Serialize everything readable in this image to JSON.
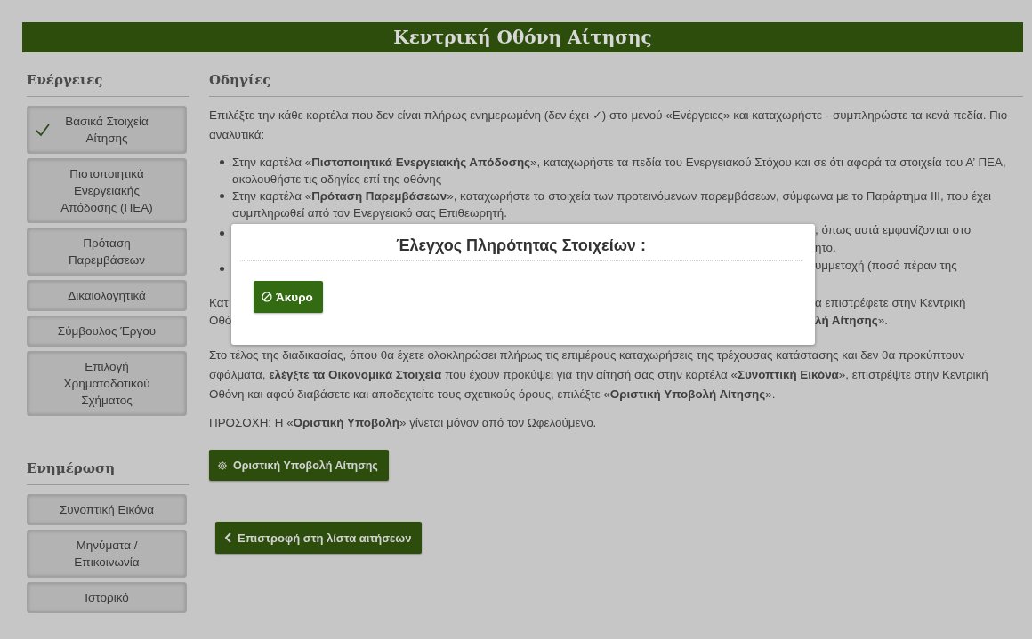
{
  "header": {
    "title": "Κεντρική Οθόνη Αίτησης"
  },
  "sidebar": {
    "sections": [
      {
        "title": "Ενέργειες",
        "items": [
          {
            "label": "Βασικά Στοιχεία Αίτησης",
            "completed": true
          },
          {
            "label": "Πιστοποιητικά Ενεργειακής Απόδοσης (ΠΕΑ)",
            "completed": false
          },
          {
            "label": "Πρόταση Παρεμβάσεων",
            "completed": false
          },
          {
            "label": "Δικαιολογητικά",
            "completed": false
          },
          {
            "label": "Σύμβουλος Έργου",
            "completed": false
          },
          {
            "label": "Επιλογή Χρηματοδοτικού Σχήματος",
            "completed": false
          }
        ]
      },
      {
        "title": "Ενημέρωση",
        "items": [
          {
            "label": "Συνοπτική Εικόνα",
            "completed": false
          },
          {
            "label": "Μηνύματα / Επικοινωνία",
            "completed": false
          },
          {
            "label": "Ιστορικό",
            "completed": false
          }
        ]
      }
    ]
  },
  "instructions": {
    "title": "Οδηγίες",
    "blocks": [
      {
        "kind": "paragraph",
        "text": "Επιλέξτε την κάθε καρτέλα που δεν είναι πλήρως ενημερωμένη (δεν έχει ✓) στο μενού «Ενέργειες» και καταχωρήστε - συμπληρώστε τα κενά πεδία. Πιο αναλυτικά:"
      },
      {
        "kind": "bullet",
        "text": "Στην καρτέλα «**Πιστοποιητικά Ενεργειακής Απόδοσης**», καταχωρήστε τα πεδία του Ενεργειακού Στόχου και σε ότι αφορά τα στοιχεία του Α’ ΠΕΑ,  ακολουθήστε τις οδηγίες επί της οθόνης"
      },
      {
        "kind": "bullet",
        "text": "Στην καρτέλα «**Πρόταση Παρεμβάσεων**», καταχωρήστε τα στοιχεία των προτεινόμενων παρεμβάσεων, σύμφωνα με το Παράρτημα ΙΙΙ, που έχει συμπληρωθεί από τον Ενεργειακό σας Επιθεωρητή."
      },
      {
        "kind": "covered",
        "lines": [
          {
            "bullet": true,
            "right": ", όπως αυτά εμφανίζονται στο"
          },
          {
            "bullet": false,
            "right": "ητο."
          },
          {
            "bullet": true,
            "right": "υμμετοχή (ποσό πέραν της"
          }
        ]
      },
      {
        "kind": "covered",
        "lines": [
          {
            "bullet": false,
            "left": "Κατ",
            "right": "α επιστρέφετε στην Κεντρική"
          },
          {
            "bullet": false,
            "left": "Οθό",
            "right": "**λή Αίτησης**»."
          }
        ]
      },
      {
        "kind": "paragraph",
        "text": "Στο τέλος της διαδικασίας, όπου θα έχετε ολοκληρώσει πλήρως τις επιμέρους καταχωρήσεις της τρέχουσας κατάστασης και δεν θα προκύπτουν σφάλματα, **ελέγξτε τα Οικονομικά Στοιχεία** που έχουν προκύψει για την αίτησή σας στην καρτέλα «**Συνοπτική Εικόνα**», επιστρέψτε στην Κεντρική Οθόνη και αφού διαβάσετε και αποδεχτείτε τους σχετικούς όρους, επιλέξτε «**Οριστική Υποβολή Αίτησης**»."
      },
      {
        "kind": "paragraph",
        "text": "ΠΡΟΣΟΧΗ: Η «**Οριστική Υποβολή**» γίνεται μόνον από τον Ωφελούμενο."
      }
    ]
  },
  "submit_button": {
    "label": "Οριστική Υποβολή Αίτησης"
  },
  "back_button": {
    "label": "Επιστροφή στη λίστα αιτήσεων"
  },
  "dialog": {
    "title": "Έλεγχος Πληρότητας Στοιχείων :",
    "cancel_button": {
      "label": "Άκυρο"
    }
  }
}
